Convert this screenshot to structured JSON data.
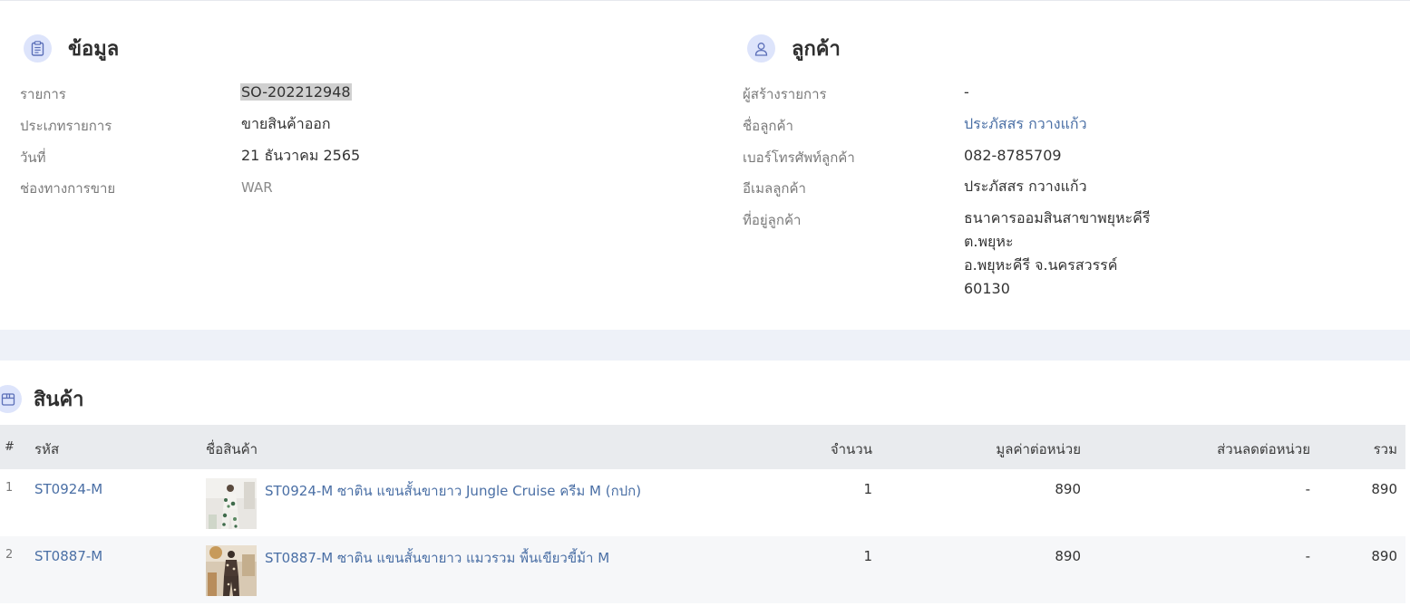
{
  "info": {
    "title": "ข้อมูล",
    "fields": [
      {
        "label": "รายการ",
        "value": "SO-202212948"
      },
      {
        "label": "ประเภทรายการ",
        "value": "ขายสินค้าออก"
      },
      {
        "label": "วันที่",
        "value": "21 ธันวาคม 2565"
      },
      {
        "label": "ช่องทางการขาย",
        "value": "WAR"
      }
    ]
  },
  "customer": {
    "title": "ลูกค้า",
    "fields": [
      {
        "label": "ผู้สร้างรายการ",
        "value": "-"
      },
      {
        "label": "ชื่อลูกค้า",
        "value": "ประภัสสร กวางแก้ว"
      },
      {
        "label": "เบอร์โทรศัพท์ลูกค้า",
        "value": "082-8785709"
      },
      {
        "label": "อีเมลลูกค้า",
        "value": "ประภัสสร กวางแก้ว"
      },
      {
        "label": "ที่อยู่ลูกค้า",
        "address": [
          "ธนาคารออมสินสาขาพยุหะคีรี",
          "ต.พยุหะ",
          "อ.พยุหะคีรี จ.นครสวรรค์",
          "60130"
        ]
      }
    ]
  },
  "products": {
    "title": "สินค้า",
    "columns": {
      "index": "#",
      "code": "รหัส",
      "name": "ชื่อสินค้า",
      "qty": "จำนวน",
      "unit_price": "มูลค่าต่อหน่วย",
      "unit_discount": "ส่วนลดต่อหน่วย",
      "total": "รวม"
    },
    "rows": [
      {
        "index": "1",
        "code": "ST0924-M",
        "name": "ST0924-M ซาติน แขนสั้นขายาว Jungle Cruise ครีม M (กปก)",
        "qty": "1",
        "unit_price": "890",
        "unit_discount": "-",
        "total": "890"
      },
      {
        "index": "2",
        "code": "ST0887-M",
        "name": "ST0887-M ซาติน แขนสั้นขายาว แมวรวม พื้นเขียวขี้ม้า M",
        "qty": "1",
        "unit_price": "890",
        "unit_discount": "-",
        "total": "890"
      }
    ]
  }
}
